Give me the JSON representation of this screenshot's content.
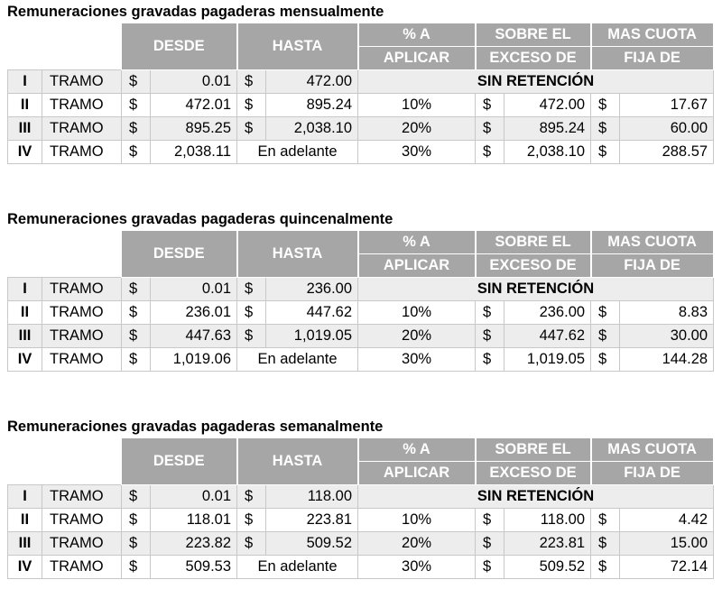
{
  "headers": {
    "desde": "DESDE",
    "hasta": "HASTA",
    "pct_line1": "% A",
    "pct_line2": "APLICAR",
    "sobre_line1": "SOBRE EL",
    "sobre_line2": "EXCESO DE",
    "cuota_line1": "MAS CUOTA",
    "cuota_line2": "FIJA DE"
  },
  "sections": [
    {
      "title": "Remuneraciones gravadas pagaderas mensualmente",
      "rows": [
        {
          "roman": "I",
          "tramo": "TRAMO",
          "cur1": "$",
          "desde": "0.01",
          "cur2": "$",
          "hasta": "472.00",
          "sin": "SIN RETENCIÓN"
        },
        {
          "roman": "II",
          "tramo": "TRAMO",
          "cur1": "$",
          "desde": "472.01",
          "cur2": "$",
          "hasta": "895.24",
          "pct": "10%",
          "cur3": "$",
          "sobre": "472.00",
          "cur4": "$",
          "cuota": "17.67"
        },
        {
          "roman": "III",
          "tramo": "TRAMO",
          "cur1": "$",
          "desde": "895.25",
          "cur2": "$",
          "hasta": "2,038.10",
          "pct": "20%",
          "cur3": "$",
          "sobre": "895.24",
          "cur4": "$",
          "cuota": "60.00"
        },
        {
          "roman": "IV",
          "tramo": "TRAMO",
          "cur1": "$",
          "desde": "2,038.11",
          "hasta_text": "En adelante",
          "pct": "30%",
          "cur3": "$",
          "sobre": "2,038.10",
          "cur4": "$",
          "cuota": "288.57"
        }
      ]
    },
    {
      "title": "Remuneraciones gravadas pagaderas quincenalmente",
      "rows": [
        {
          "roman": "I",
          "tramo": "TRAMO",
          "cur1": "$",
          "desde": "0.01",
          "cur2": "$",
          "hasta": "236.00",
          "sin": "SIN RETENCIÓN"
        },
        {
          "roman": "II",
          "tramo": "TRAMO",
          "cur1": "$",
          "desde": "236.01",
          "cur2": "$",
          "hasta": "447.62",
          "pct": "10%",
          "cur3": "$",
          "sobre": "236.00",
          "cur4": "$",
          "cuota": "8.83"
        },
        {
          "roman": "III",
          "tramo": "TRAMO",
          "cur1": "$",
          "desde": "447.63",
          "cur2": "$",
          "hasta": "1,019.05",
          "pct": "20%",
          "cur3": "$",
          "sobre": "447.62",
          "cur4": "$",
          "cuota": "30.00"
        },
        {
          "roman": "IV",
          "tramo": "TRAMO",
          "cur1": "$",
          "desde": "1,019.06",
          "hasta_text": "En adelante",
          "pct": "30%",
          "cur3": "$",
          "sobre": "1,019.05",
          "cur4": "$",
          "cuota": "144.28"
        }
      ]
    },
    {
      "title": "Remuneraciones gravadas pagaderas semanalmente",
      "rows": [
        {
          "roman": "I",
          "tramo": "TRAMO",
          "cur1": "$",
          "desde": "0.01",
          "cur2": "$",
          "hasta": "118.00",
          "sin": "SIN RETENCIÓN"
        },
        {
          "roman": "II",
          "tramo": "TRAMO",
          "cur1": "$",
          "desde": "118.01",
          "cur2": "$",
          "hasta": "223.81",
          "pct": "10%",
          "cur3": "$",
          "sobre": "118.00",
          "cur4": "$",
          "cuota": "4.42"
        },
        {
          "roman": "III",
          "tramo": "TRAMO",
          "cur1": "$",
          "desde": "223.82",
          "cur2": "$",
          "hasta": "509.52",
          "pct": "20%",
          "cur3": "$",
          "sobre": "223.81",
          "cur4": "$",
          "cuota": "15.00"
        },
        {
          "roman": "IV",
          "tramo": "TRAMO",
          "cur1": "$",
          "desde": "509.53",
          "hasta_text": "En adelante",
          "pct": "30%",
          "cur3": "$",
          "sobre": "509.52",
          "cur4": "$",
          "cuota": "72.14"
        }
      ]
    }
  ]
}
